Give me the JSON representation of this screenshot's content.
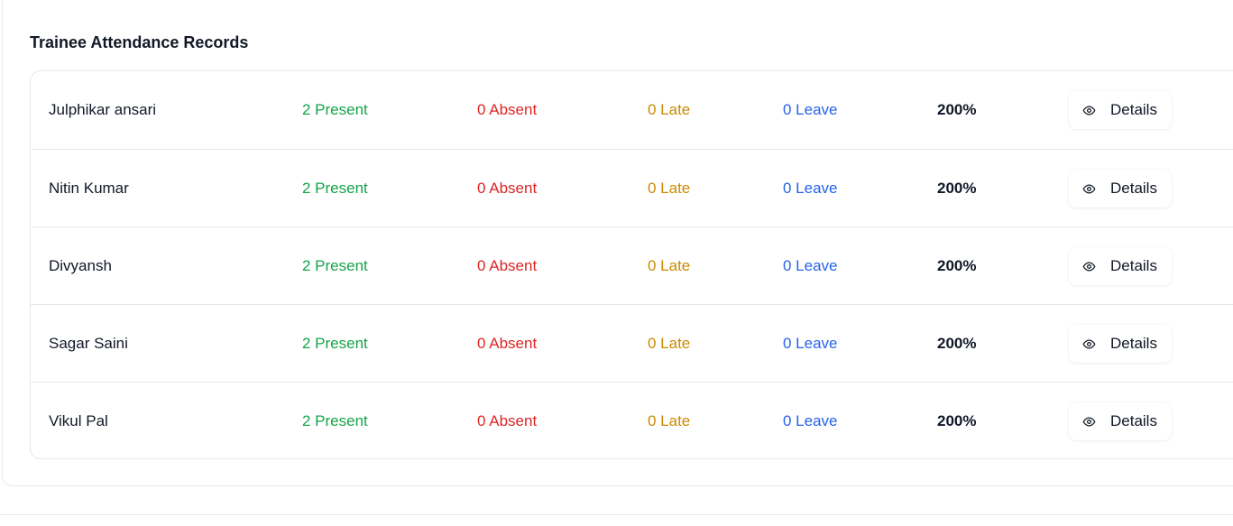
{
  "section": {
    "title": "Trainee Attendance Records"
  },
  "rows": [
    {
      "name": "Julphikar ansari",
      "present": "2 Present",
      "absent": "0 Absent",
      "late": "0 Late",
      "leave": "0 Leave",
      "percent": "200%",
      "details_label": "Details"
    },
    {
      "name": "Nitin Kumar",
      "present": "2 Present",
      "absent": "0 Absent",
      "late": "0 Late",
      "leave": "0 Leave",
      "percent": "200%",
      "details_label": "Details"
    },
    {
      "name": "Divyansh",
      "present": "2 Present",
      "absent": "0 Absent",
      "late": "0 Late",
      "leave": "0 Leave",
      "percent": "200%",
      "details_label": "Details"
    },
    {
      "name": "Sagar Saini",
      "present": "2 Present",
      "absent": "0 Absent",
      "late": "0 Late",
      "leave": "0 Leave",
      "percent": "200%",
      "details_label": "Details"
    },
    {
      "name": "Vikul Pal",
      "present": "2 Present",
      "absent": "0 Absent",
      "late": "0 Late",
      "leave": "0 Leave",
      "percent": "200%",
      "details_label": "Details"
    }
  ],
  "colors": {
    "present": "#16a34a",
    "absent": "#dc2626",
    "late": "#ca8a04",
    "leave": "#2563eb"
  },
  "icons": {
    "details": "eye-icon"
  }
}
